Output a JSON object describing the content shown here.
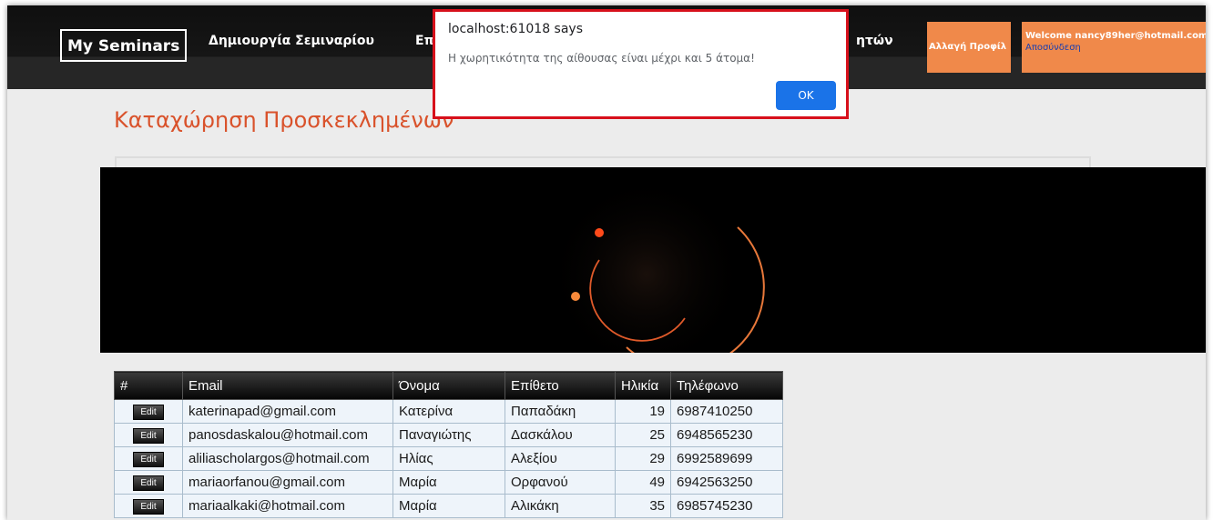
{
  "navbar": {
    "brand": "My Seminars",
    "links": [
      "Δημιουργία Σεμιναρίου",
      "Επ",
      "ητών"
    ],
    "profile_button": "Αλλαγή Προφίλ",
    "welcome": "Welcome nancy89her@hotmail.com",
    "logout": "Αποσύνδεση"
  },
  "dialog": {
    "title": "localhost:61018 says",
    "message": "Η χωρητικότητα της αίθουσας είναι μέχρι και 5 άτομα!",
    "ok": "OK"
  },
  "page": {
    "title": "Καταχώρηση Προσκεκλημένων"
  },
  "colors": {
    "accent": "#f0894a",
    "title": "#d9522b",
    "dialog_border": "#d7101b",
    "ok_button": "#1a73e8"
  },
  "table": {
    "headers": [
      "#",
      "Email",
      "Όνομα",
      "Επίθετο",
      "Ηλικία",
      "Τηλέφωνο"
    ],
    "rows": [
      {
        "action": "Edit",
        "email": "katerinapad@gmail.com",
        "name": "Κατερίνα",
        "surname": "Παπαδάκη",
        "age": "19",
        "phone": "6987410250"
      },
      {
        "action": "Edit",
        "email": "panosdaskalou@hotmail.com",
        "name": "Παναγιώτης",
        "surname": "Δασκάλου",
        "age": "25",
        "phone": "6948565230"
      },
      {
        "action": "Edit",
        "email": "aliliascholargos@hotmail.com",
        "name": "Ηλίας",
        "surname": "Αλεξίου",
        "age": "29",
        "phone": "6992589699"
      },
      {
        "action": "Edit",
        "email": "mariaorfanou@gmail.com",
        "name": "Μαρία",
        "surname": "Ορφανού",
        "age": "49",
        "phone": "6942563250"
      },
      {
        "action": "Edit",
        "email": "mariaalkaki@hotmail.com",
        "name": "Μαρία",
        "surname": "Αλικάκη",
        "age": "35",
        "phone": "6985745230"
      }
    ]
  }
}
